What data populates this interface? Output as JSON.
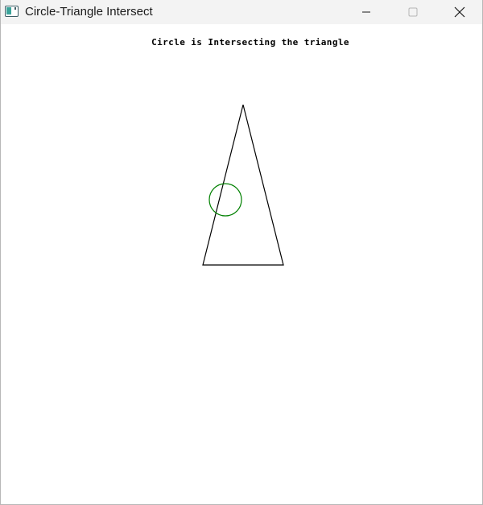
{
  "window": {
    "title": "Circle-Triangle Intersect",
    "icon": "app-window-icon",
    "controls": {
      "minimize_icon": "minimize-icon",
      "maximize_icon": "maximize-icon",
      "close_icon": "close-icon"
    }
  },
  "canvas": {
    "background": "#ffffff",
    "status_message": "Circle is Intersecting the triangle",
    "triangle": {
      "stroke": "#000000"
    },
    "circle": {
      "stroke": "#008000"
    }
  }
}
